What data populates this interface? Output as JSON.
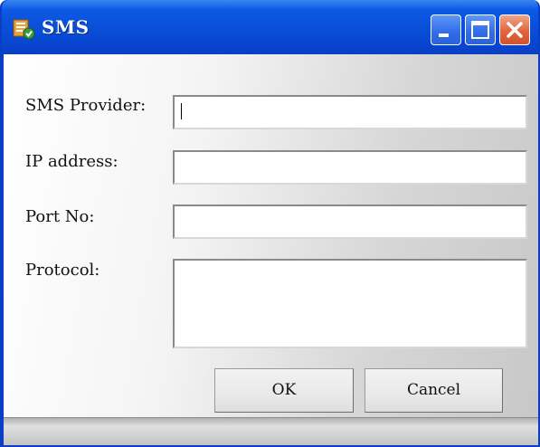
{
  "window": {
    "title": "SMS",
    "controls": {
      "minimize": "minimize-icon",
      "maximize": "maximize-icon",
      "close": "close-icon"
    },
    "icon": "app-icon"
  },
  "form": {
    "sms_provider": {
      "label": "SMS Provider:",
      "value": ""
    },
    "ip_address": {
      "label": "IP address:",
      "value": ""
    },
    "port_no": {
      "label": "Port No:",
      "value": ""
    },
    "protocol": {
      "label": "Protocol:",
      "value": ""
    }
  },
  "buttons": {
    "ok_label": "OK",
    "cancel_label": "Cancel"
  },
  "colors": {
    "titlebar": "#0a4fd8",
    "close_button": "#e2643c",
    "window_background": "#e8e8e8"
  }
}
